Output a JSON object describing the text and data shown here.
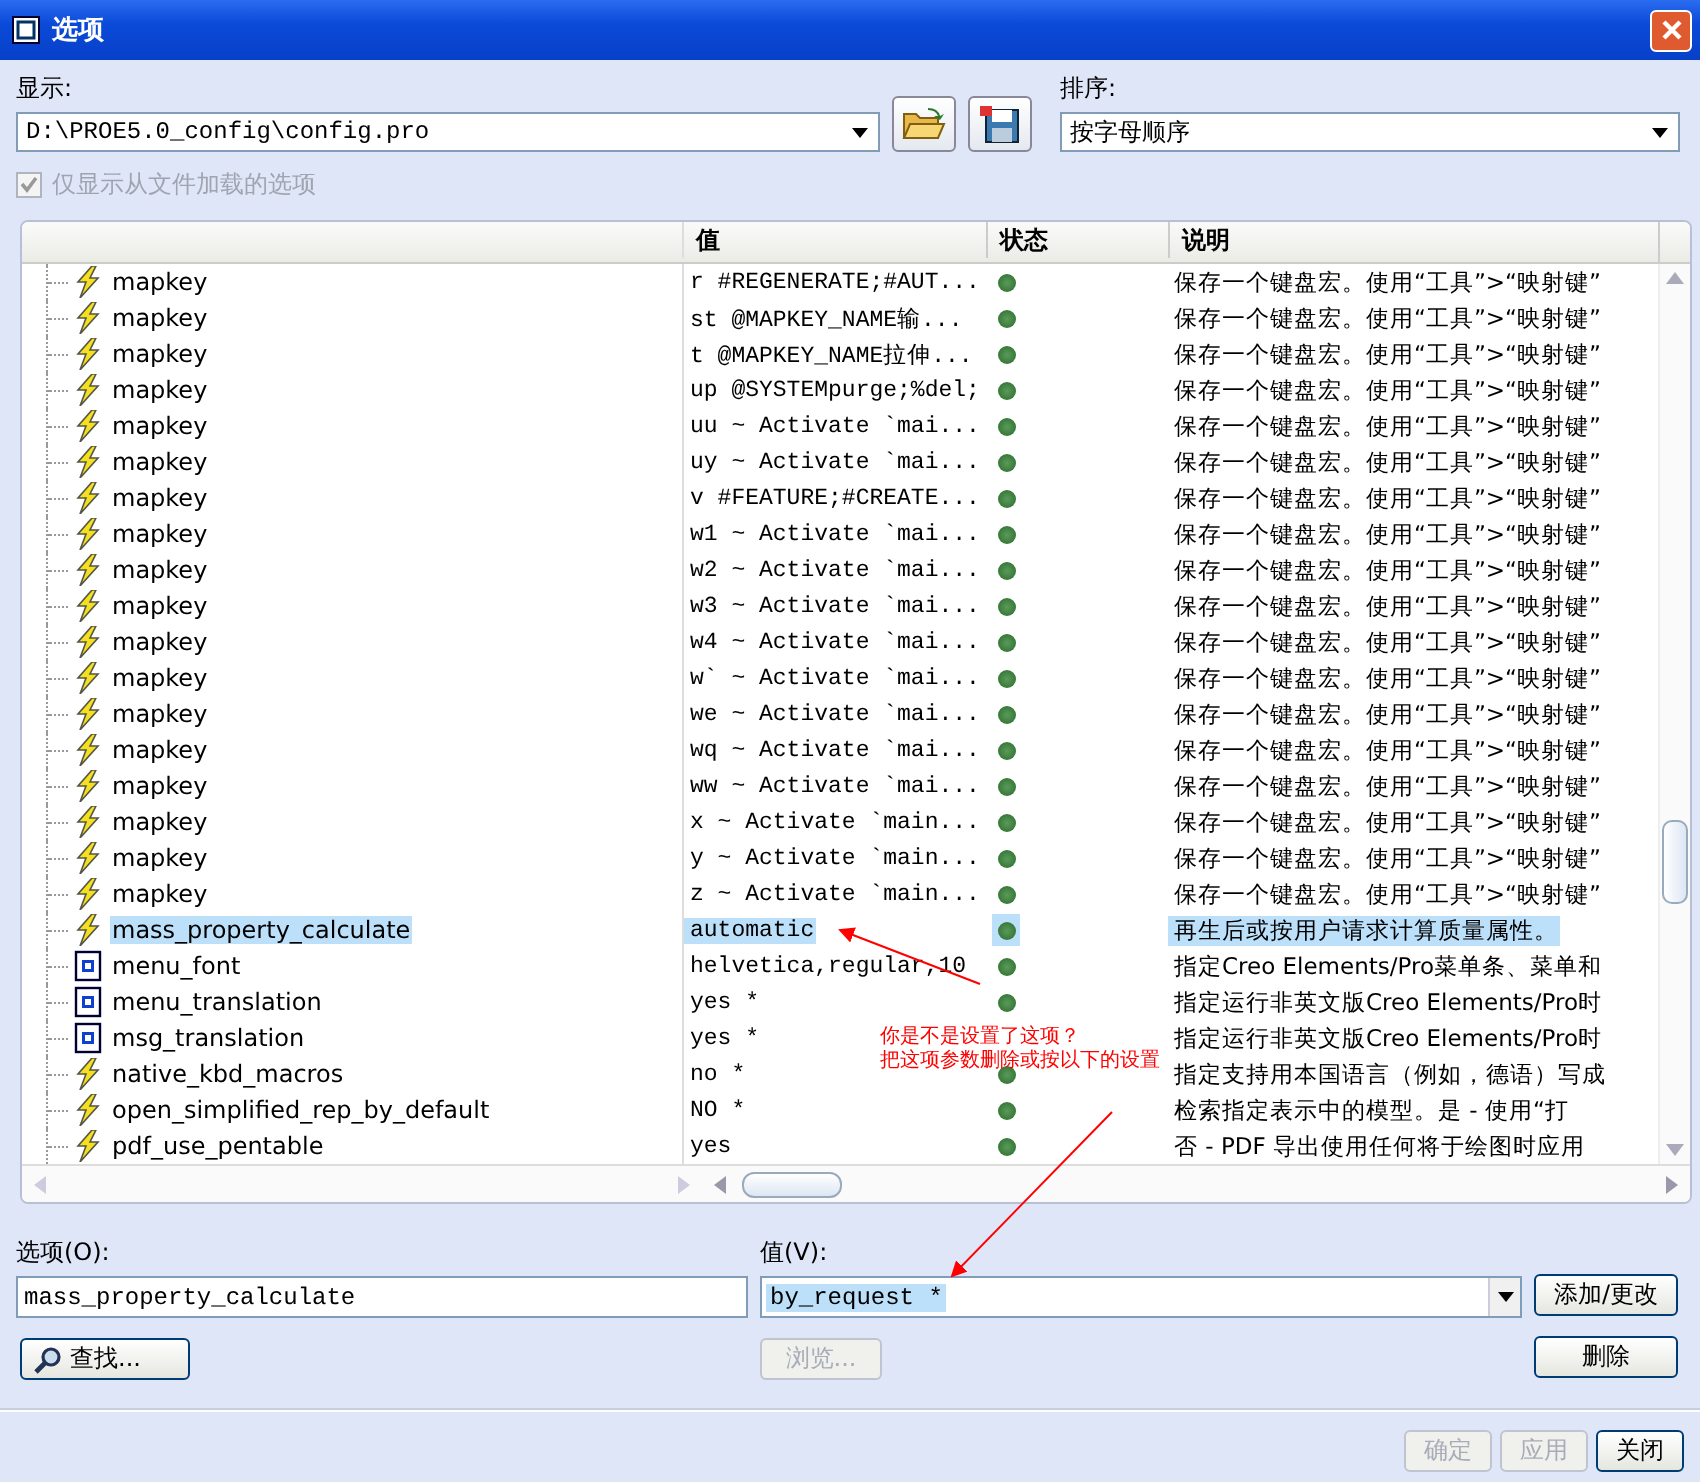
{
  "window": {
    "title": "选项"
  },
  "display": {
    "label": "显示:",
    "value": "D:\\PROE5.0_config\\config.pro"
  },
  "sort": {
    "label": "排序:",
    "value": "按字母顺序"
  },
  "filter_checkbox": {
    "label": "仅显示从文件加载的选项",
    "checked": true,
    "disabled": true
  },
  "table": {
    "columns": [
      "值",
      "状态",
      "说明"
    ],
    "rows": [
      {
        "name": "mapkey",
        "kind": "bolt",
        "value": "r #REGENERATE;#AUT...",
        "description": "保存一个键盘宏。使用“工具”>“映射键”",
        "selected": false
      },
      {
        "name": "mapkey",
        "kind": "bolt",
        "value": "st @MAPKEY_NAME输...",
        "description": "保存一个键盘宏。使用“工具”>“映射键”",
        "selected": false
      },
      {
        "name": "mapkey",
        "kind": "bolt",
        "value": "t @MAPKEY_NAME拉伸...",
        "description": "保存一个键盘宏。使用“工具”>“映射键”",
        "selected": false
      },
      {
        "name": "mapkey",
        "kind": "bolt",
        "value": "up @SYSTEMpurge;%del;",
        "description": "保存一个键盘宏。使用“工具”>“映射键”",
        "selected": false
      },
      {
        "name": "mapkey",
        "kind": "bolt",
        "value": "uu ~ Activate `mai...",
        "description": "保存一个键盘宏。使用“工具”>“映射键”",
        "selected": false
      },
      {
        "name": "mapkey",
        "kind": "bolt",
        "value": "uy ~ Activate `mai...",
        "description": "保存一个键盘宏。使用“工具”>“映射键”",
        "selected": false
      },
      {
        "name": "mapkey",
        "kind": "bolt",
        "value": "v #FEATURE;#CREATE...",
        "description": "保存一个键盘宏。使用“工具”>“映射键”",
        "selected": false
      },
      {
        "name": "mapkey",
        "kind": "bolt",
        "value": "w1 ~ Activate `mai...",
        "description": "保存一个键盘宏。使用“工具”>“映射键”",
        "selected": false
      },
      {
        "name": "mapkey",
        "kind": "bolt",
        "value": "w2 ~ Activate `mai...",
        "description": "保存一个键盘宏。使用“工具”>“映射键”",
        "selected": false
      },
      {
        "name": "mapkey",
        "kind": "bolt",
        "value": "w3 ~ Activate `mai...",
        "description": "保存一个键盘宏。使用“工具”>“映射键”",
        "selected": false
      },
      {
        "name": "mapkey",
        "kind": "bolt",
        "value": "w4 ~ Activate `mai...",
        "description": "保存一个键盘宏。使用“工具”>“映射键”",
        "selected": false
      },
      {
        "name": "mapkey",
        "kind": "bolt",
        "value": "w` ~ Activate `mai...",
        "description": "保存一个键盘宏。使用“工具”>“映射键”",
        "selected": false
      },
      {
        "name": "mapkey",
        "kind": "bolt",
        "value": "we ~ Activate `mai...",
        "description": "保存一个键盘宏。使用“工具”>“映射键”",
        "selected": false
      },
      {
        "name": "mapkey",
        "kind": "bolt",
        "value": "wq ~ Activate `mai...",
        "description": "保存一个键盘宏。使用“工具”>“映射键”",
        "selected": false
      },
      {
        "name": "mapkey",
        "kind": "bolt",
        "value": "ww ~ Activate `mai...",
        "description": "保存一个键盘宏。使用“工具”>“映射键”",
        "selected": false
      },
      {
        "name": "mapkey",
        "kind": "bolt",
        "value": "x ~ Activate `main...",
        "description": "保存一个键盘宏。使用“工具”>“映射键”",
        "selected": false
      },
      {
        "name": "mapkey",
        "kind": "bolt",
        "value": "y ~ Activate `main...",
        "description": "保存一个键盘宏。使用“工具”>“映射键”",
        "selected": false
      },
      {
        "name": "mapkey",
        "kind": "bolt",
        "value": "z ~ Activate `main...",
        "description": "保存一个键盘宏。使用“工具”>“映射键”",
        "selected": false
      },
      {
        "name": "mass_property_calculate",
        "kind": "bolt",
        "value": "automatic",
        "description": "再生后或按用户请求计算质量属性。",
        "selected": true
      },
      {
        "name": "menu_font",
        "kind": "box",
        "value": "helvetica,regular,10",
        "description": "指定Creo Elements/Pro菜单条、菜单和",
        "selected": false
      },
      {
        "name": "menu_translation",
        "kind": "box",
        "value": "yes *",
        "description": "指定运行非英文版Creo Elements/Pro时",
        "selected": false
      },
      {
        "name": "msg_translation",
        "kind": "box",
        "value": "yes *",
        "description": "指定运行非英文版Creo Elements/Pro时",
        "selected": false,
        "status_hidden": true
      },
      {
        "name": "native_kbd_macros",
        "kind": "bolt",
        "value": "no *",
        "description": "指定支持用本国语言（例如，德语）写成",
        "selected": false
      },
      {
        "name": "open_simplified_rep_by_default",
        "kind": "bolt",
        "value": "NO *",
        "description": "检索指定表示中的模型。是 - 使用“打",
        "selected": false
      },
      {
        "name": "pdf_use_pentable",
        "kind": "bolt",
        "value": "yes",
        "description": "否 - PDF 导出使用任何将于绘图时应用",
        "selected": false
      }
    ]
  },
  "option_field": {
    "label": "选项(O):",
    "value": "mass_property_calculate"
  },
  "value_field": {
    "label": "值(V):",
    "value": "by_request *"
  },
  "side_buttons": [
    {
      "label": "添加/更改",
      "disabled": false
    },
    {
      "label": "删除",
      "disabled": false
    }
  ],
  "find_button": {
    "label": "查找..."
  },
  "browse_button": {
    "label": "浏览...",
    "disabled": true
  },
  "footer_buttons": [
    {
      "label": "确定",
      "disabled": true
    },
    {
      "label": "应用",
      "disabled": true
    },
    {
      "label": "关闭",
      "disabled": false
    }
  ],
  "annotation": {
    "lines": [
      "你是不是设置了这项？",
      "把这项参数删除或按以下的设置"
    ]
  }
}
